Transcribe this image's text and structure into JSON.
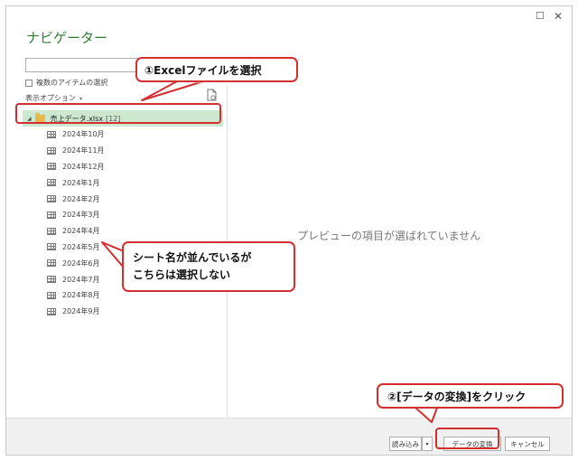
{
  "window": {
    "title": "ナビゲーター",
    "maximize_glyph": "☐",
    "close_glyph": "✕"
  },
  "left_pane": {
    "search_value": "",
    "multi_select_label": "複数のアイテムの選択",
    "display_options_label": "表示オプション",
    "dropdown_glyph": "▾",
    "root": {
      "expand_glyph": "◢",
      "name": "売上データ.xlsx",
      "count": "[12]"
    },
    "sheets": [
      "2024年10月",
      "2024年11月",
      "2024年12月",
      "2024年1月",
      "2024年2月",
      "2024年3月",
      "2024年4月",
      "2024年5月",
      "2024年6月",
      "2024年7月",
      "2024年8月",
      "2024年9月"
    ]
  },
  "preview": {
    "message": "プレビューの項目が選ばれていません"
  },
  "footer": {
    "load_label": "読み込み",
    "load_arrow": "▾",
    "transform_label": "データの変換",
    "cancel_label": "キャンセル"
  },
  "annotations": {
    "callout1": "①Excelファイルを選択",
    "callout2_line1": "シート名が並んでいるが",
    "callout2_line2": "こちらは選択しない",
    "callout3": "②[データの変換]をクリック",
    "color": "#d32f2f"
  }
}
